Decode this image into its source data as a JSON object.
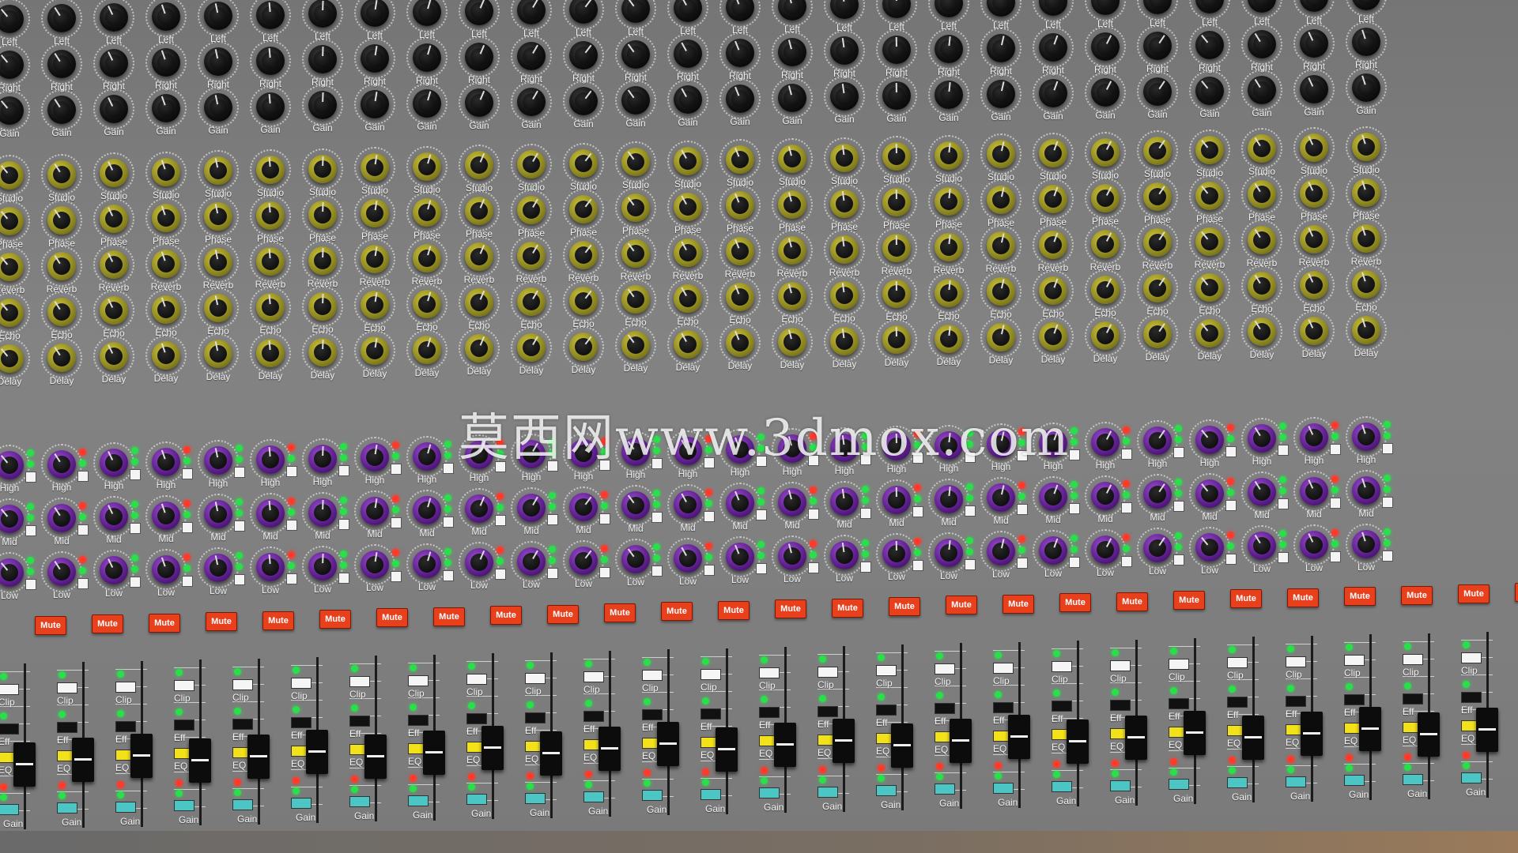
{
  "console": {
    "channel_count": 27,
    "rows": {
      "pan": [
        {
          "label": "Left",
          "style": "black"
        },
        {
          "label": "Right",
          "style": "black"
        },
        {
          "label": "Gain",
          "style": "black"
        }
      ],
      "fx": [
        {
          "label": "Studio",
          "style": "yellow"
        },
        {
          "label": "Phase",
          "style": "yellow"
        },
        {
          "label": "Reverb",
          "style": "yellow"
        },
        {
          "label": "Echo",
          "style": "yellow"
        },
        {
          "label": "Delay",
          "style": "yellow"
        }
      ],
      "eq": [
        {
          "label": "High",
          "style": "purple"
        },
        {
          "label": "Mid",
          "style": "purple"
        },
        {
          "label": "Low",
          "style": "purple"
        }
      ]
    },
    "mute_label": "Mute",
    "strip_labels": {
      "clip": "Clip",
      "eff": "Eff",
      "eq": "EQ",
      "gain": "Gain"
    }
  },
  "watermark": "莫西网www.3dmox.com",
  "colors": {
    "panel": "#7d7d7d",
    "knob_black": "#111111",
    "knob_yellow": "#b5ad2a",
    "knob_purple": "#6a2a9a",
    "mute_red": "#e8401c",
    "led_green": "#29e04a",
    "led_red": "#ff3a2a",
    "pad_yellow": "#f3e21a",
    "pad_teal": "#4cc6c4"
  }
}
